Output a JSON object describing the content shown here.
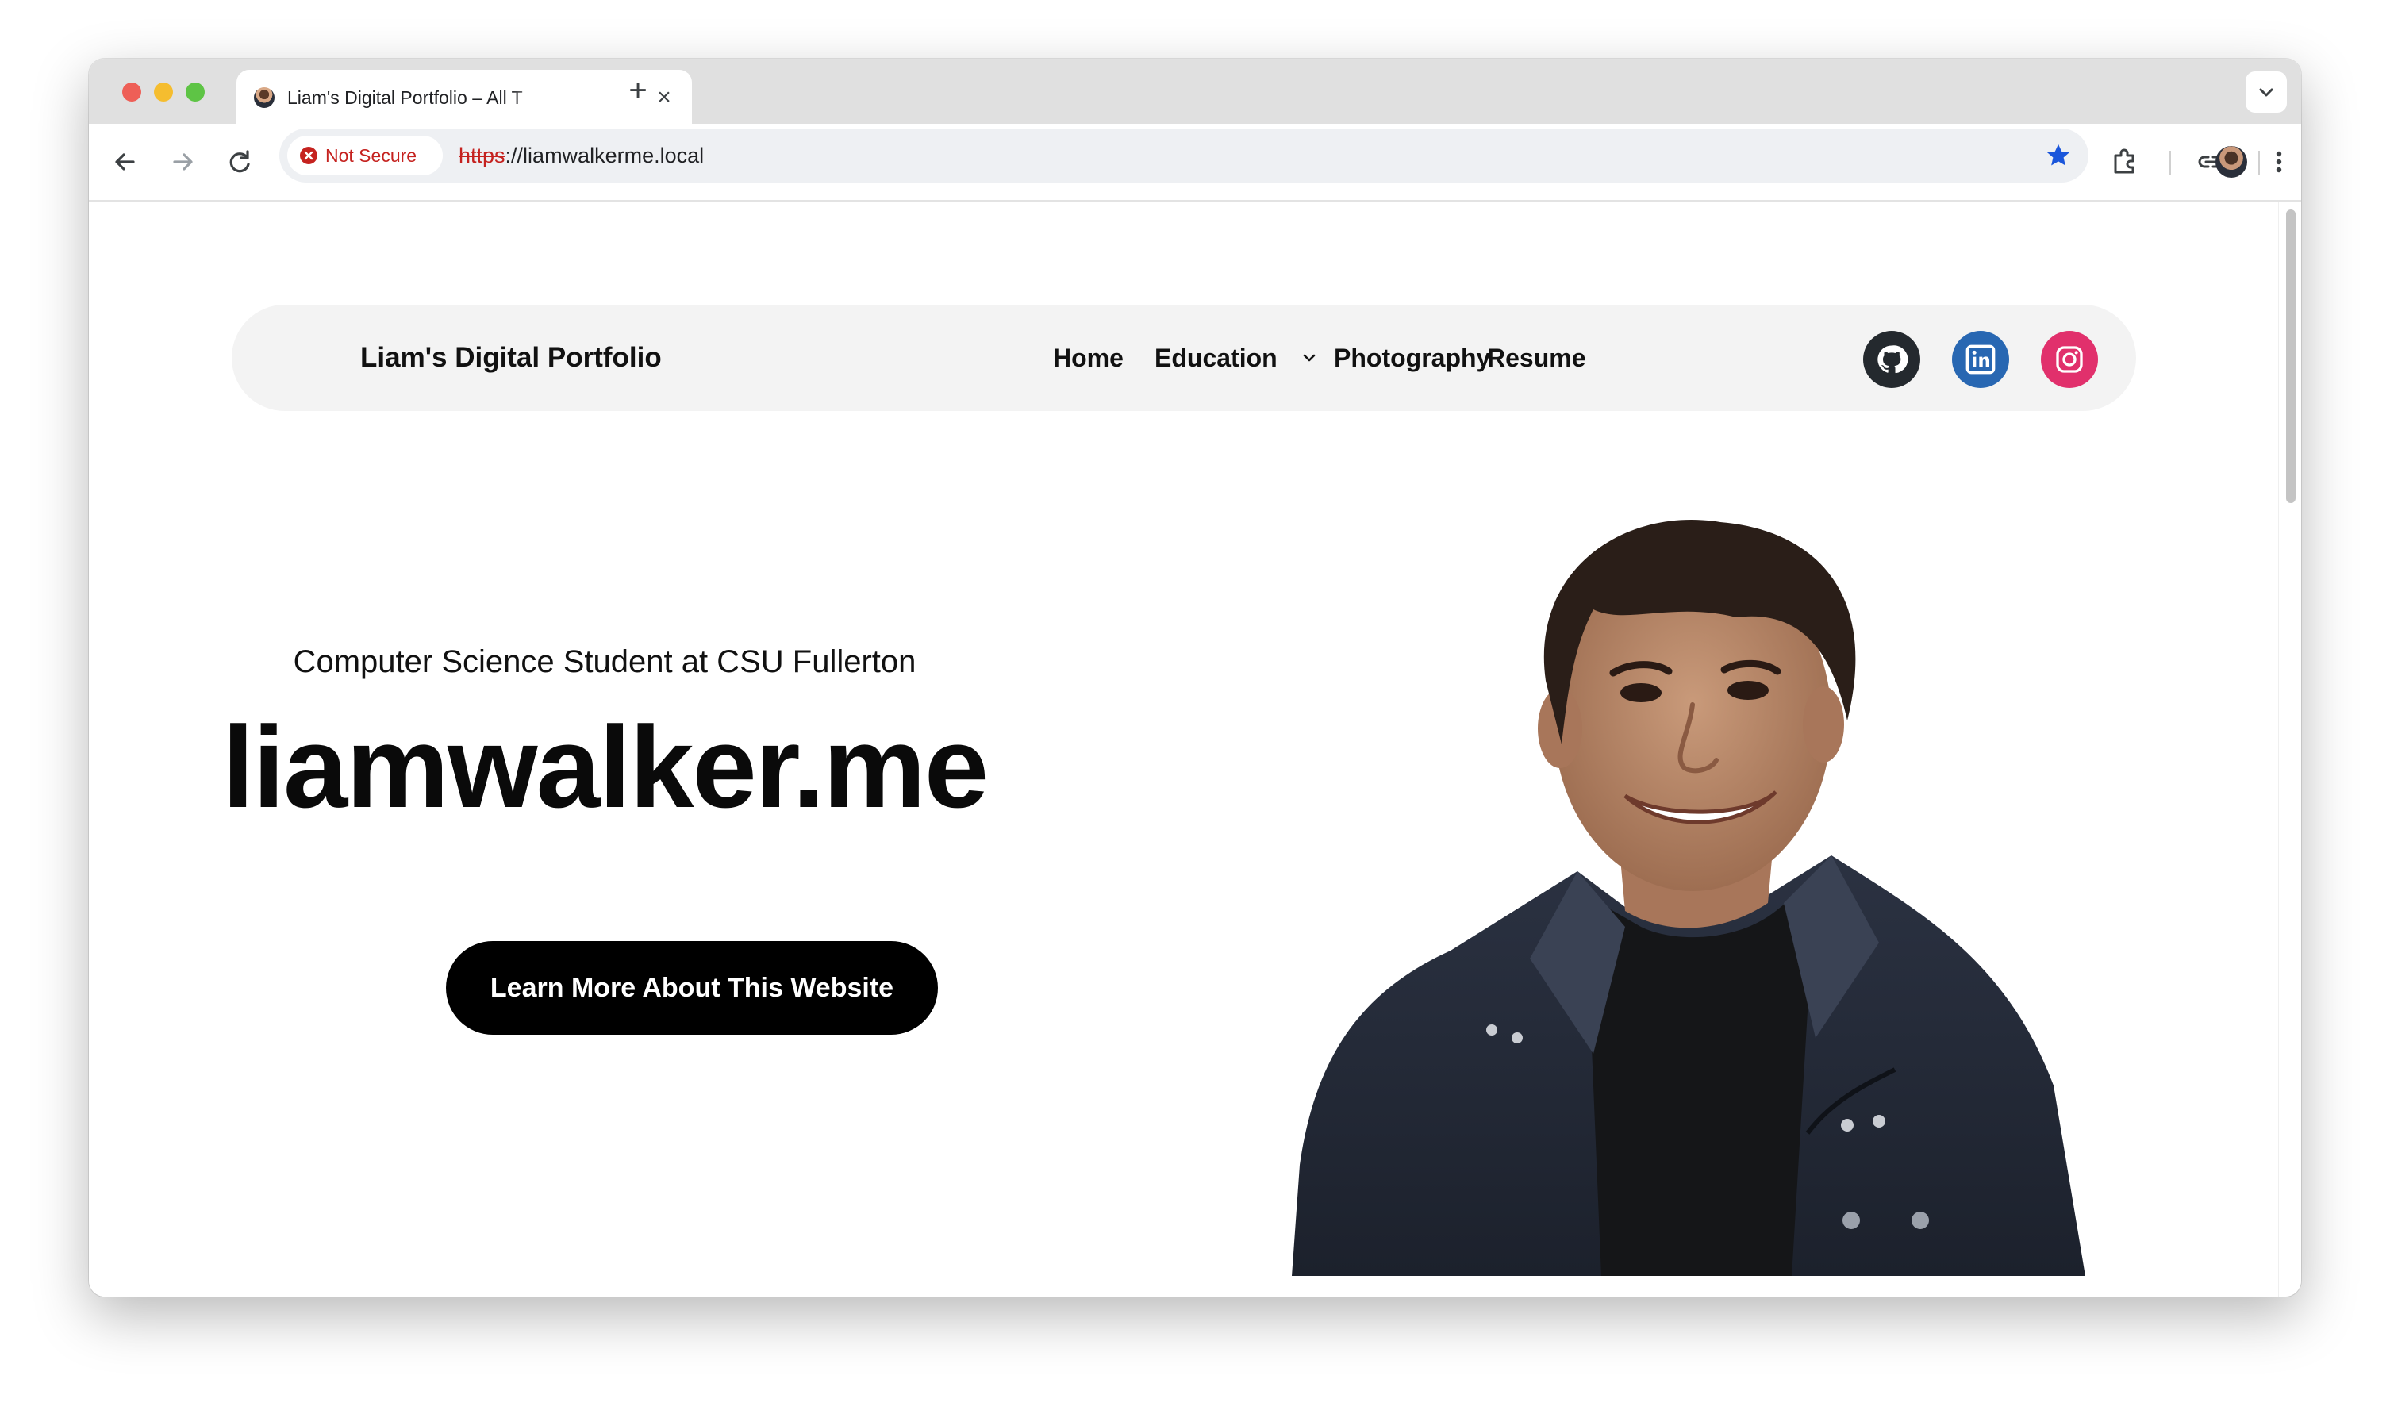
{
  "browser": {
    "tab_title": "Liam's Digital Portfolio – All T",
    "tab_close_glyph": "×",
    "new_tab_glyph": "+",
    "security_label": "Not Secure",
    "url_scheme": "https",
    "url_rest": "://liamwalkerme.local",
    "icons": [
      "back-arrow-icon",
      "forward-arrow-icon",
      "reload-icon",
      "bookmark-star-icon",
      "extensions-icon",
      "link-icon",
      "profile-avatar",
      "kebab-menu-icon",
      "tab-search-chevron-icon"
    ]
  },
  "site": {
    "title": "Liam's Digital Portfolio",
    "nav": [
      "Home",
      "Education",
      "Photography",
      "Resume"
    ],
    "social": [
      "github-icon",
      "linkedin-icon",
      "instagram-icon"
    ],
    "colors": {
      "github": "#24292e",
      "linkedin": "#2867b2",
      "instagram": "#e1306c",
      "cta": "#000000"
    }
  },
  "hero": {
    "subtitle": "Computer Science Student at CSU Fullerton",
    "title": "liamwalker.me",
    "cta": "Learn More About This Website"
  }
}
